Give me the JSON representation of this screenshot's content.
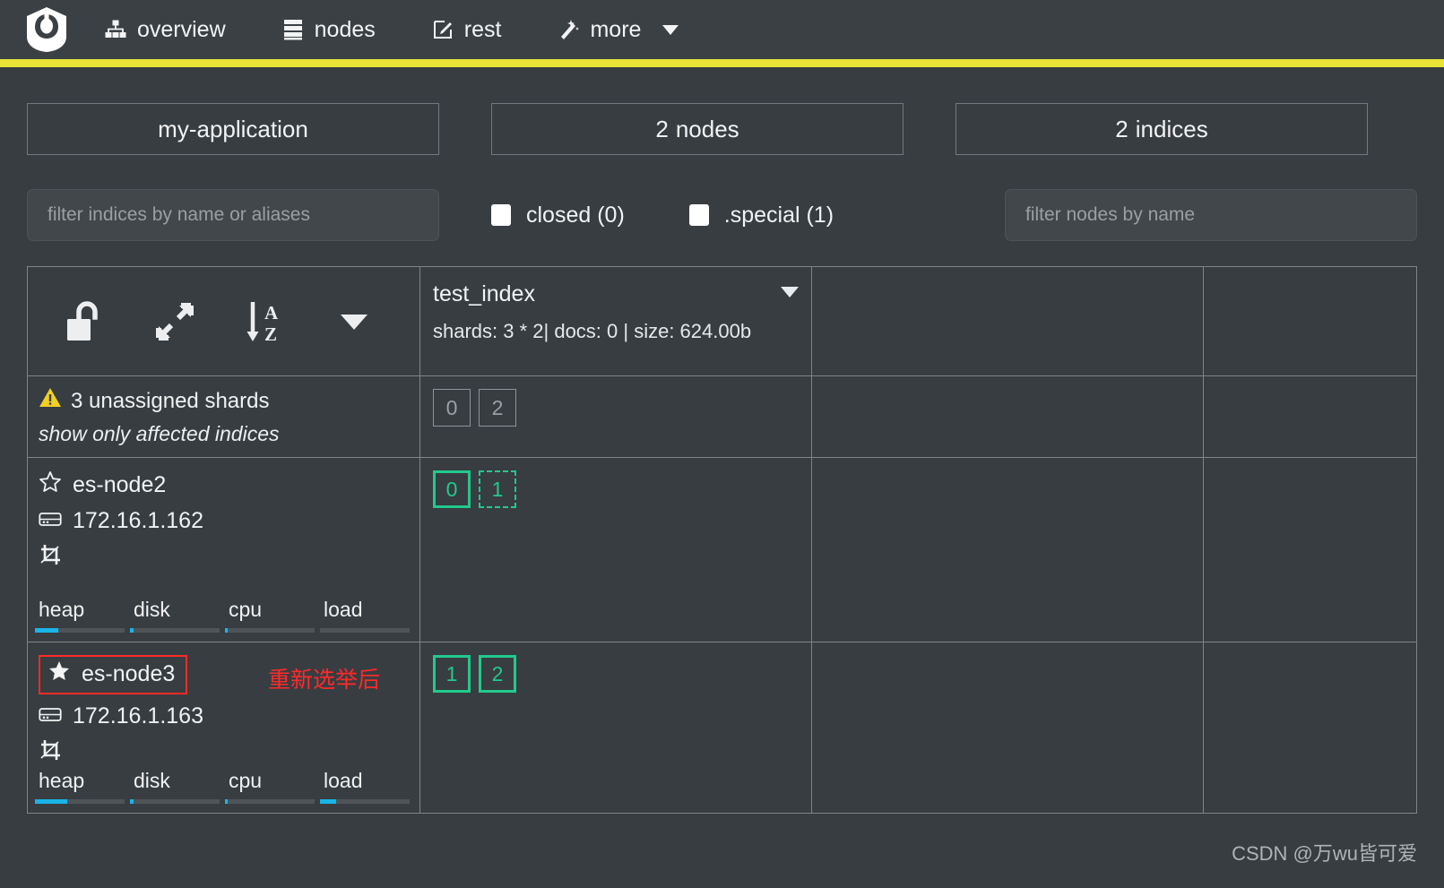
{
  "navbar": {
    "logo_name": "cerebro-logo",
    "items": [
      {
        "label": "overview",
        "icon": "sitemap-icon"
      },
      {
        "label": "nodes",
        "icon": "server-stack-icon"
      },
      {
        "label": "rest",
        "icon": "edit-square-icon"
      },
      {
        "label": "more",
        "icon": "magic-wand-icon",
        "has_caret": true
      }
    ],
    "accent_bar_color": "#e8e337"
  },
  "summary": {
    "cluster_name": "my-application",
    "nodes_count": "2",
    "nodes_label": "nodes",
    "indices_count": "2",
    "indices_label": "indices"
  },
  "filters": {
    "indices_placeholder": "filter indices by name or aliases",
    "indices_value": "",
    "nodes_placeholder": "filter nodes by name",
    "nodes_value": "",
    "closed_label": "closed (0)",
    "special_label": ".special (1)"
  },
  "toolbar": {
    "lock_icon": "open-lock-icon",
    "expand_icon": "expand-arrows-icon",
    "sort_icon": "sort-alpha-asc-icon",
    "caret_icon": "chevron-down-icon"
  },
  "index": {
    "name": "test_index",
    "meta": "shards: 3 * 2| docs: 0 | size: 624.00b",
    "caret_icon": "chevron-down-icon"
  },
  "unassigned": {
    "warning_icon": "warning-triangle-icon",
    "text": "3 unassigned shards",
    "link": "show only affected indices",
    "shards": [
      "0",
      "2"
    ]
  },
  "nodes": [
    {
      "name": "es-node2",
      "star_icon": "star-outline-icon",
      "ip": "172.16.1.162",
      "ip_icon": "hard-drive-icon",
      "role_icon": "data-node-icon",
      "highlighted": false,
      "annotation": "",
      "metrics": [
        {
          "label": "heap",
          "percent": 26
        },
        {
          "label": "disk",
          "percent": 4
        },
        {
          "label": "cpu",
          "percent": 3
        },
        {
          "label": "load",
          "percent": 0
        }
      ],
      "shards": [
        {
          "value": "0",
          "type": "primary"
        },
        {
          "value": "1",
          "type": "replica"
        }
      ]
    },
    {
      "name": "es-node3",
      "star_icon": "star-filled-icon",
      "ip": "172.16.1.163",
      "ip_icon": "hard-drive-icon",
      "role_icon": "data-node-icon",
      "highlighted": true,
      "annotation": "重新选举后",
      "metrics": [
        {
          "label": "heap",
          "percent": 36
        },
        {
          "label": "disk",
          "percent": 4
        },
        {
          "label": "cpu",
          "percent": 3
        },
        {
          "label": "load",
          "percent": 18
        }
      ],
      "shards": [
        {
          "value": "1",
          "type": "primary"
        },
        {
          "value": "2",
          "type": "primary"
        }
      ]
    }
  ],
  "watermark": "CSDN @万wu皆可爱",
  "colors": {
    "background": "#383d41",
    "navbar": "#3b4044",
    "accent_yellow": "#e8e337",
    "shard_green": "#22c98c",
    "highlight_red": "#ff2a2a",
    "metric_blue": "#19b5e8",
    "warning_yellow": "#f2d024"
  }
}
